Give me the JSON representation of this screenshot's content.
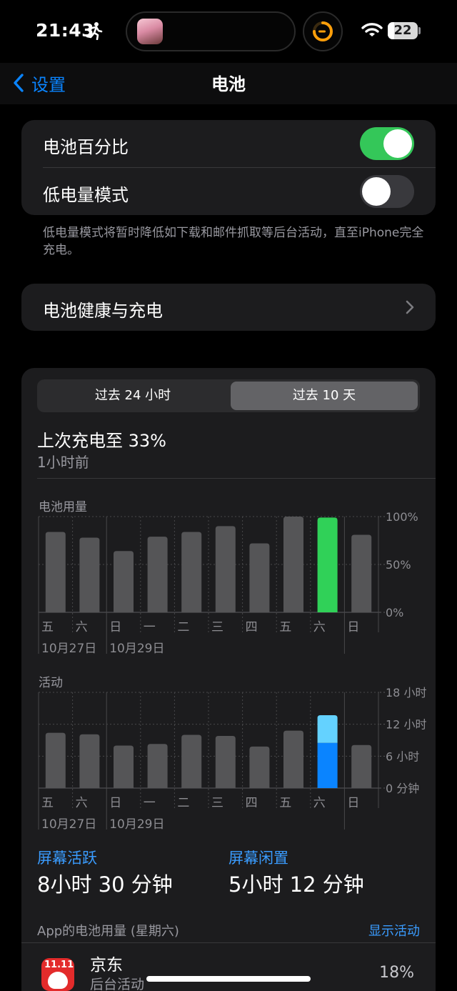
{
  "status_bar": {
    "time": "21:43",
    "battery_level": "22",
    "battery_fraction": 0.22
  },
  "nav": {
    "back_label": "设置",
    "title": "电池"
  },
  "settings": {
    "battery_percentage_label": "电池百分比",
    "battery_percentage_on": true,
    "low_power_label": "低电量模式",
    "low_power_on": false,
    "low_power_footnote": "低电量模式将暂时降低如下载和邮件抓取等后台活动，直至iPhone完全充电。"
  },
  "health": {
    "label": "电池健康与充电"
  },
  "usage": {
    "segments": [
      "过去 24 小时",
      "过去 10 天"
    ],
    "selected_segment": 1,
    "last_charge_text": "上次充电至 33%",
    "last_charge_ago": "1小时前",
    "battery_chart_label": "电池用量",
    "activity_chart_label": "活动",
    "screen_on_label": "屏幕活跃",
    "screen_on_value": "8小时 30 分钟",
    "screen_idle_label": "屏幕闲置",
    "screen_idle_value": "5小时 12 分钟",
    "app_usage_header": "App的电池用量 (星期六)",
    "show_activity_label": "显示活动"
  },
  "chart_data": [
    {
      "type": "bar",
      "title": "电池用量",
      "categories": [
        "五",
        "六",
        "日",
        "一",
        "二",
        "三",
        "四",
        "五",
        "六",
        "日"
      ],
      "date_labels": [
        {
          "text": "10月27日",
          "index": 0
        },
        {
          "text": "10月29日",
          "index": 2
        }
      ],
      "values": [
        84,
        78,
        64,
        79,
        84,
        90,
        72,
        100,
        99,
        81
      ],
      "y_unit": "%",
      "ylim": [
        0,
        100
      ],
      "y_ticks": [
        "100%",
        "50%",
        "0%"
      ],
      "highlight_index": 8,
      "colors": {
        "bar": "#555557",
        "highlight": "#30d158"
      }
    },
    {
      "type": "bar",
      "title": "活动",
      "categories": [
        "五",
        "六",
        "日",
        "一",
        "二",
        "三",
        "四",
        "五",
        "六",
        "日"
      ],
      "date_labels": [
        {
          "text": "10月27日",
          "index": 0
        },
        {
          "text": "10月29日",
          "index": 2
        }
      ],
      "values_hours": [
        10.4,
        10.1,
        8.0,
        8.3,
        10.0,
        9.8,
        7.8,
        10.8,
        13.7,
        8.1
      ],
      "series": [
        {
          "name": "屏幕活跃",
          "values_hours": [
            null,
            null,
            null,
            null,
            null,
            null,
            null,
            null,
            8.5,
            null
          ]
        },
        {
          "name": "屏幕闲置",
          "values_hours": [
            null,
            null,
            null,
            null,
            null,
            null,
            null,
            null,
            5.2,
            null
          ]
        }
      ],
      "ylim": [
        0,
        18
      ],
      "y_ticks": [
        "18 小时",
        "12 小时",
        "6 小时",
        "0 分钟"
      ],
      "highlight_index": 8,
      "colors": {
        "bar": "#555557",
        "screen_on": "#0a84ff",
        "screen_idle": "#64d2ff"
      }
    }
  ],
  "apps": [
    {
      "name": "京东",
      "subtitle": "后台活动",
      "percent": "18%",
      "icon": "jd-icon",
      "icon_tag": "11.11"
    }
  ]
}
